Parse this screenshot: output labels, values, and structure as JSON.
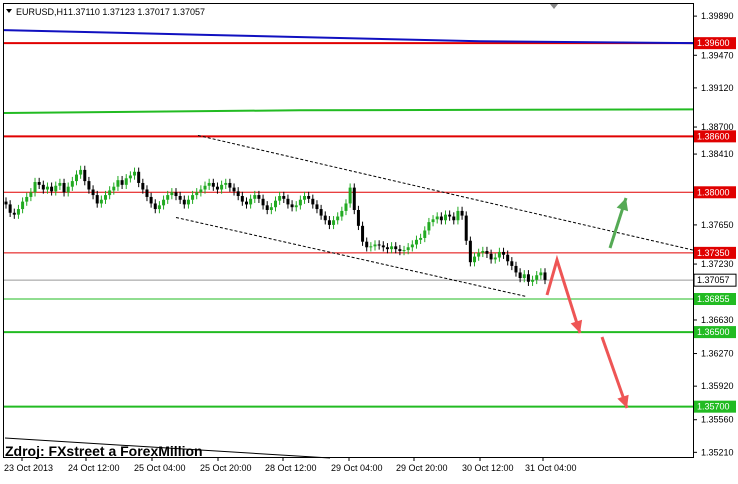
{
  "header": {
    "symbol": "EURUSD,H1",
    "ohlc": "1.37110 1.37123 1.37017 1.37057"
  },
  "watermark": "Zdroj: FXstreet a ForexMillion",
  "colors": {
    "bull": "#22aa22",
    "bear": "#000000",
    "resistance": "#e00000",
    "support": "#22bb22",
    "ma_blue": "#1010c0",
    "arrow_up": "#55aa55",
    "arrow_down": "#ee5555"
  },
  "chart_data": {
    "type": "candlestick",
    "symbol": "EURUSD",
    "timeframe": "H1",
    "x_tick_labels": [
      "23 Oct 2013",
      "24 Oct 12:00",
      "25 Oct 04:00",
      "25 Oct 20:00",
      "28 Oct 12:00",
      "29 Oct 04:00",
      "29 Oct 20:00",
      "30 Oct 12:00",
      "31 Oct 04:00"
    ],
    "y_tick_labels": [
      "1.39890",
      "1.39470",
      "1.39120",
      "1.38700",
      "1.38410",
      "1.37990",
      "1.37650",
      "1.37230",
      "1.36880",
      "1.36630",
      "1.36270",
      "1.35920",
      "1.35560",
      "1.35210"
    ],
    "ylim": [
      1.3516,
      1.4002
    ],
    "current_price": "1.37057",
    "levels": [
      {
        "label": "1.39600",
        "value": 1.396,
        "kind": "resistance"
      },
      {
        "label": "1.38600",
        "value": 1.386,
        "kind": "resistance"
      },
      {
        "label": "1.38000",
        "value": 1.38,
        "kind": "resistance"
      },
      {
        "label": "1.37350",
        "value": 1.3735,
        "kind": "resistance"
      },
      {
        "label": "1.36855",
        "value": 1.36855,
        "kind": "support"
      },
      {
        "label": "1.36500",
        "value": 1.365,
        "kind": "support"
      },
      {
        "label": "1.35700",
        "value": 1.357,
        "kind": "support"
      }
    ],
    "close_series": [
      1.3787,
      1.3778,
      1.3776,
      1.3782,
      1.379,
      1.3795,
      1.38,
      1.3811,
      1.3808,
      1.3803,
      1.3806,
      1.3801,
      1.3807,
      1.381,
      1.38,
      1.3806,
      1.3812,
      1.3819,
      1.3824,
      1.3812,
      1.3803,
      1.3797,
      1.3788,
      1.3792,
      1.3797,
      1.3802,
      1.3806,
      1.3813,
      1.3808,
      1.3815,
      1.3818,
      1.3822,
      1.381,
      1.3803,
      1.3795,
      1.3788,
      1.3782,
      1.3786,
      1.3792,
      1.3797,
      1.38,
      1.3796,
      1.3792,
      1.3787,
      1.3792,
      1.3797,
      1.38,
      1.3803,
      1.3807,
      1.381,
      1.3806,
      1.3803,
      1.3808,
      1.381,
      1.3805,
      1.3801,
      1.3796,
      1.379,
      1.3787,
      1.3793,
      1.3797,
      1.3793,
      1.3786,
      1.3781,
      1.3784,
      1.3791,
      1.3796,
      1.3793,
      1.3787,
      1.3784,
      1.3786,
      1.3792,
      1.3796,
      1.3793,
      1.3787,
      1.3782,
      1.3775,
      1.377,
      1.3765,
      1.377,
      1.3774,
      1.378,
      1.3788,
      1.3805,
      1.3781,
      1.3764,
      1.3747,
      1.3741,
      1.3742,
      1.3744,
      1.3743,
      1.3741,
      1.3739,
      1.3742,
      1.3739,
      1.3737,
      1.3738,
      1.3741,
      1.3744,
      1.3749,
      1.3751,
      1.3759,
      1.3768,
      1.3771,
      1.3774,
      1.377,
      1.3776,
      1.3774,
      1.377,
      1.378,
      1.3775,
      1.3748,
      1.3725,
      1.3731,
      1.3735,
      1.3737,
      1.3734,
      1.3728,
      1.373,
      1.3736,
      1.3733,
      1.3726,
      1.3721,
      1.3714,
      1.3708,
      1.3712,
      1.3704,
      1.3706,
      1.3711,
      1.3714,
      1.3706
    ],
    "dashed_channel": {
      "upper": [
        [
          "25 Oct 20:00",
          1.3861
        ],
        [
          "31 Oct 12:00",
          1.3738
        ]
      ],
      "lower": [
        [
          "25 Oct 04:00",
          1.3773
        ],
        [
          "31 Oct 04:00",
          1.3688
        ]
      ]
    },
    "moving_averages": [
      {
        "color": "blue",
        "values": [
          1.3974,
          1.3969,
          1.3962,
          1.396
        ]
      },
      {
        "color": "green",
        "values": [
          1.3885,
          1.3888,
          1.3889
        ]
      }
    ]
  }
}
